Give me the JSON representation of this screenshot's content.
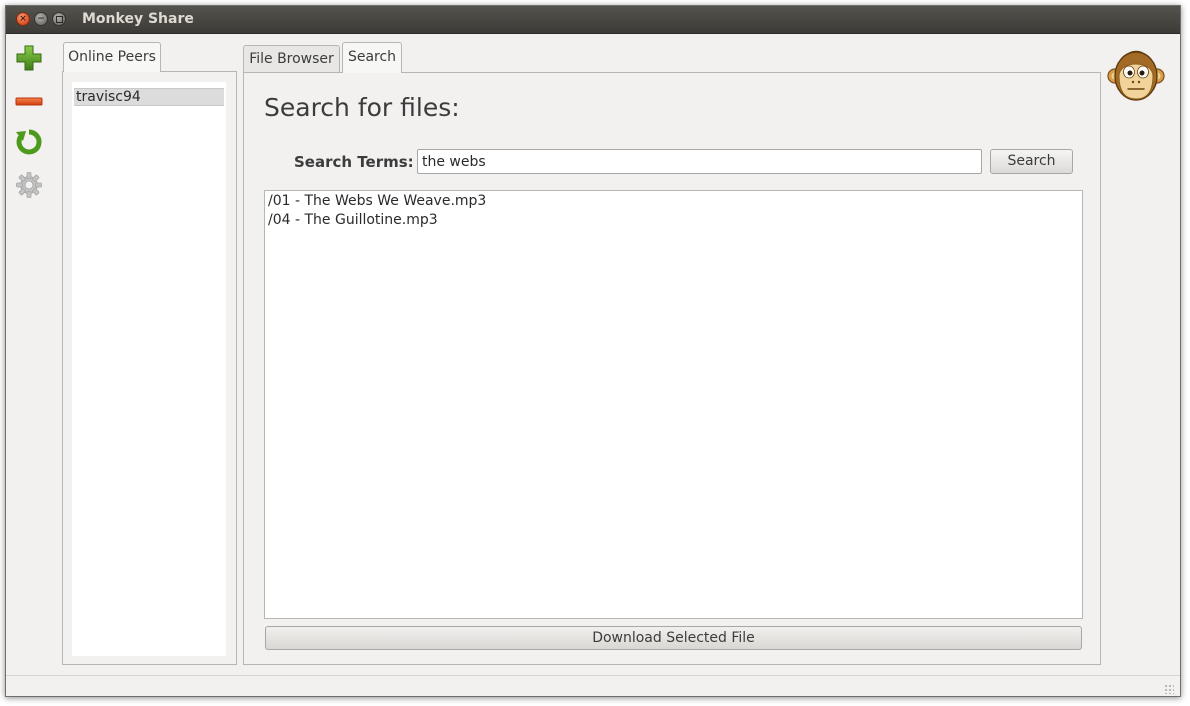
{
  "window": {
    "title": "Monkey Share",
    "close_glyph": "×",
    "min_glyph": "−"
  },
  "toolbar": {
    "items": [
      {
        "name": "add-peer",
        "icon": "plus-icon",
        "color": "#5a9a2a"
      },
      {
        "name": "remove-peer",
        "icon": "minus-icon",
        "color": "#e2541e"
      },
      {
        "name": "refresh",
        "icon": "refresh-icon",
        "color": "#4e9a1c"
      },
      {
        "name": "settings",
        "icon": "gear-icon",
        "color": "#b8b8b8"
      }
    ]
  },
  "peers": {
    "tab_label": "Online Peers",
    "items": [
      "travisc94"
    ]
  },
  "tabs": {
    "file_browser": "File Browser",
    "search": "Search"
  },
  "search": {
    "heading": "Search for files:",
    "terms_label": "Search Terms:",
    "terms_value": "the webs",
    "button_label": "Search",
    "results": [
      "/01 - The Webs We Weave.mp3",
      "/04 - The Guillotine.mp3"
    ],
    "download_label": "Download Selected File"
  },
  "branding": {
    "logo_icon": "monkey-logo-icon"
  }
}
